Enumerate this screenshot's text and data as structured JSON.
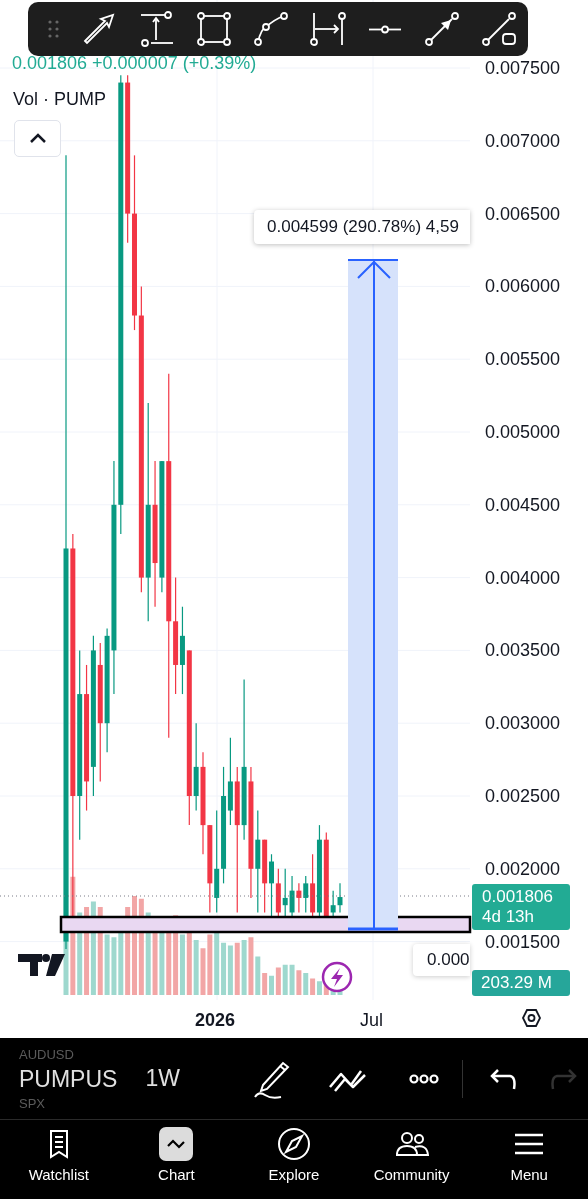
{
  "legend": {
    "price": "0.001806",
    "change": "+0.000007 (+0.39%)",
    "volume_label": "Vol · PUMP"
  },
  "price_axis": {
    "ticks": [
      "0.007500",
      "0.007000",
      "0.006500",
      "0.006000",
      "0.005500",
      "0.005000",
      "0.004500",
      "0.004000",
      "0.003500",
      "0.003000",
      "0.002500",
      "0.002000",
      "0.001500"
    ]
  },
  "measure_label": "0.004599 (290.78%) 4,59",
  "crosshair_label": "0.000",
  "last_price": {
    "price": "0.001806",
    "countdown": "4d 13h"
  },
  "volume_value": "203.29 M",
  "time_axis": {
    "labels": [
      "2026",
      "Jul"
    ]
  },
  "toolbar": {
    "symbols": [
      {
        "label": "AUDUSD",
        "selected": false
      },
      {
        "label": "PUMPUS",
        "selected": true
      },
      {
        "label": "SPX",
        "selected": false
      }
    ],
    "interval": "1W",
    "redo_disabled": true
  },
  "nav": [
    {
      "label": "Watchlist",
      "selected": false,
      "kind": "watchlist"
    },
    {
      "label": "Chart",
      "selected": true,
      "kind": "chart"
    },
    {
      "label": "Explore",
      "selected": false,
      "kind": "explore"
    },
    {
      "label": "Community",
      "selected": false,
      "kind": "community"
    },
    {
      "label": "Menu",
      "selected": false,
      "kind": "menu"
    }
  ]
}
